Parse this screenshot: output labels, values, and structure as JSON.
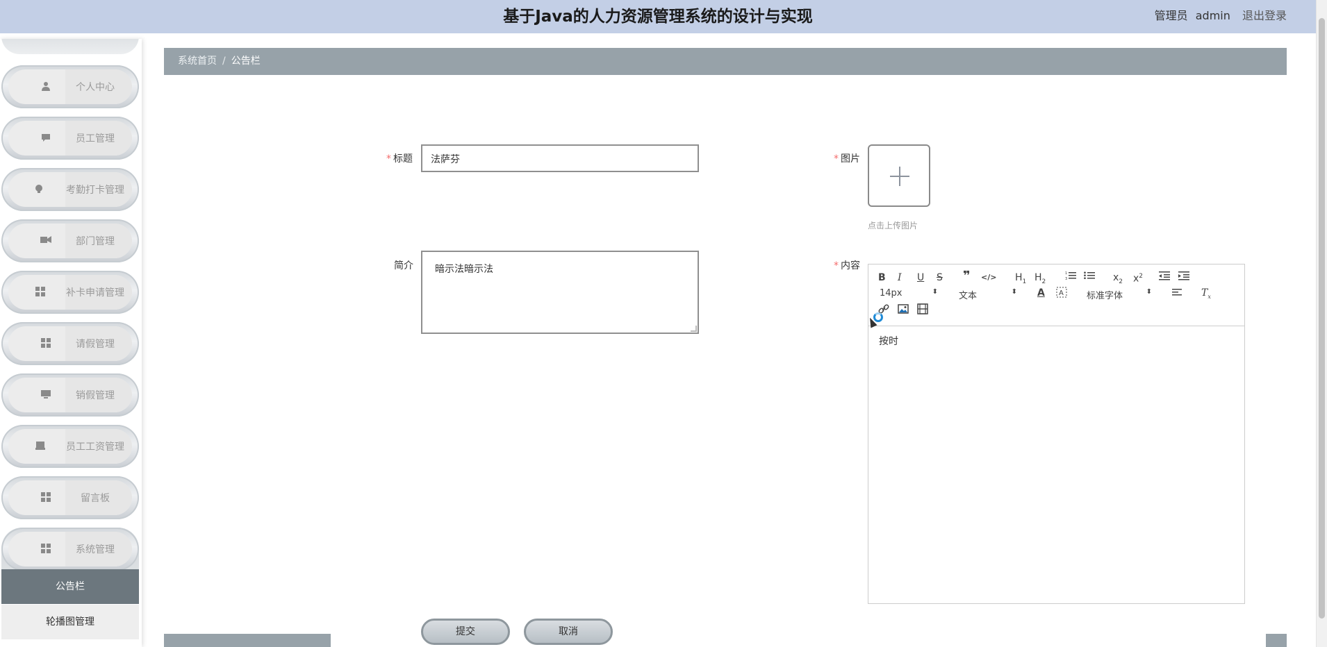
{
  "header": {
    "title": "基于Java的人力资源管理系统的设计与实现",
    "role": "管理员",
    "username": "admin",
    "logout": "退出登录"
  },
  "sidebar": {
    "items": [
      {
        "label": "个人中心",
        "icon": "person-icon"
      },
      {
        "label": "员工管理",
        "icon": "chat-icon"
      },
      {
        "label": "考勤打卡管理",
        "icon": "bulb-icon"
      },
      {
        "label": "部门管理",
        "icon": "camera-icon"
      },
      {
        "label": "补卡申请管理",
        "icon": "grid-icon"
      },
      {
        "label": "请假管理",
        "icon": "grid-icon"
      },
      {
        "label": "销假管理",
        "icon": "monitor-icon"
      },
      {
        "label": "员工工资管理",
        "icon": "inbox-icon"
      },
      {
        "label": "留言板",
        "icon": "grid-icon"
      },
      {
        "label": "系统管理",
        "icon": "grid-icon"
      }
    ],
    "submenu": {
      "active": "公告栏",
      "other": "轮播图管理"
    }
  },
  "breadcrumb": {
    "home": "系统首页",
    "separator": "/",
    "current": "公告栏"
  },
  "form": {
    "title_label": "标题",
    "title_value": "法萨芬",
    "intro_label": "简介",
    "intro_value": "暗示法暗示法",
    "image_label": "图片",
    "upload_tip": "点击上传图片",
    "content_label": "内容",
    "content_value": "按时",
    "submit": "提交",
    "cancel": "取消"
  },
  "editor": {
    "toolbar_row1": [
      "B",
      "I",
      "U",
      "S",
      "❞",
      "</>",
      "H1",
      "H2",
      "ol",
      "ul",
      "x₂",
      "x²",
      "outdent",
      "indent"
    ],
    "font_size": "14px",
    "header_select": "文本",
    "font_family": "标准字体"
  },
  "colors": {
    "header_bg": "#c3cfe6",
    "breadcrumb_bg": "#97a2a9",
    "active_submenu": "#6c777e",
    "required": "#f56c6c"
  }
}
